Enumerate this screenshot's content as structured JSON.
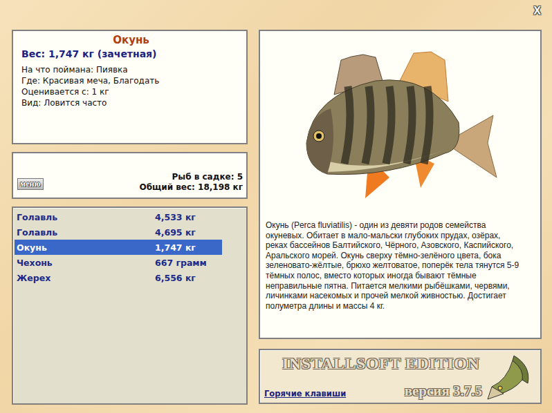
{
  "window": {
    "close": "X"
  },
  "fish_card": {
    "title": "Окунь",
    "weight": "Вес: 1,747 кг (зачетная)",
    "details": [
      "На что поймана: Пиявка",
      "Где: Красивая меча, Благодать",
      "Оценивается с: 1 кг",
      "Вид: Ловится часто"
    ]
  },
  "keepnet": {
    "menu": "меню",
    "count": "Рыб в садке: 5",
    "total": "Общий вес: 18,198 кг"
  },
  "catch_list": [
    {
      "name": "Голавль",
      "weight": "4,533 кг",
      "selected": false
    },
    {
      "name": "Голавль",
      "weight": "4,695 кг",
      "selected": false
    },
    {
      "name": "Окунь",
      "weight": "1,747 кг",
      "selected": true
    },
    {
      "name": "Чехонь",
      "weight": "667 грамм",
      "selected": false
    },
    {
      "name": "Жерех",
      "weight": "6,556 кг",
      "selected": false
    }
  ],
  "description": "Окунь (Perca fluviatilis) - один из девяти родов семейства окуневых. Обитает в мало-мальски глубоких прудах, озёрах, реках бассейнов Балтийского, Чёрного, Азовского, Каспийского, Аральского морей. Окунь сверху тёмно-зелёного цвета, бока зеленовато-жёлтые, брюхо желтоватое, поперёк тела тянутся 5-9 тёмных полос, вместо которых иногда бывают тёмные неправильные пятна. Питается мелкими рыбёшками, червями, личинками насекомых и прочей мелкой живностью. Достигает полуметра длины и массы 4 кг.",
  "footer": {
    "edition": "INSTALLSOFT EDITION",
    "hotkeys": "Горячие клавиши",
    "version": "версия 3.7.5"
  }
}
